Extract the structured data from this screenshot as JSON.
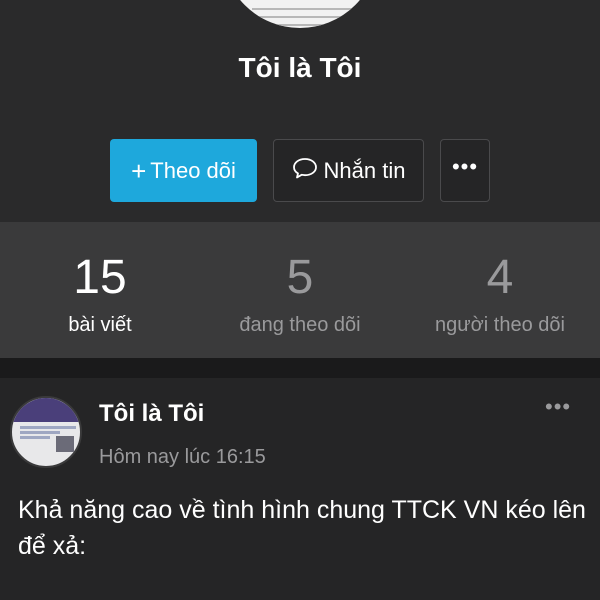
{
  "profile": {
    "name": "Tôi là Tôi"
  },
  "actions": {
    "follow_label": "Theo dõi",
    "follow_icon": "plus-icon",
    "message_label": "Nhắn tin",
    "message_icon": "speech-bubble-icon",
    "more_label": "•••"
  },
  "stats": [
    {
      "value": "15",
      "label": "bài viết"
    },
    {
      "value": "5",
      "label": "đang theo dõi"
    },
    {
      "value": "4",
      "label": "người theo dõi"
    }
  ],
  "post": {
    "author": "Tôi là Tôi",
    "time": "Hôm nay lúc 16:15",
    "menu_label": "•••",
    "body": "Khả năng cao về tình hình chung TTCK VN kéo lên để xả:"
  },
  "colors": {
    "accent": "#1ea8dc",
    "background": "#1a1a1b",
    "header": "#2a2a2b",
    "stats_bar": "#3a3a3b",
    "muted_text": "#9a9a9c"
  }
}
